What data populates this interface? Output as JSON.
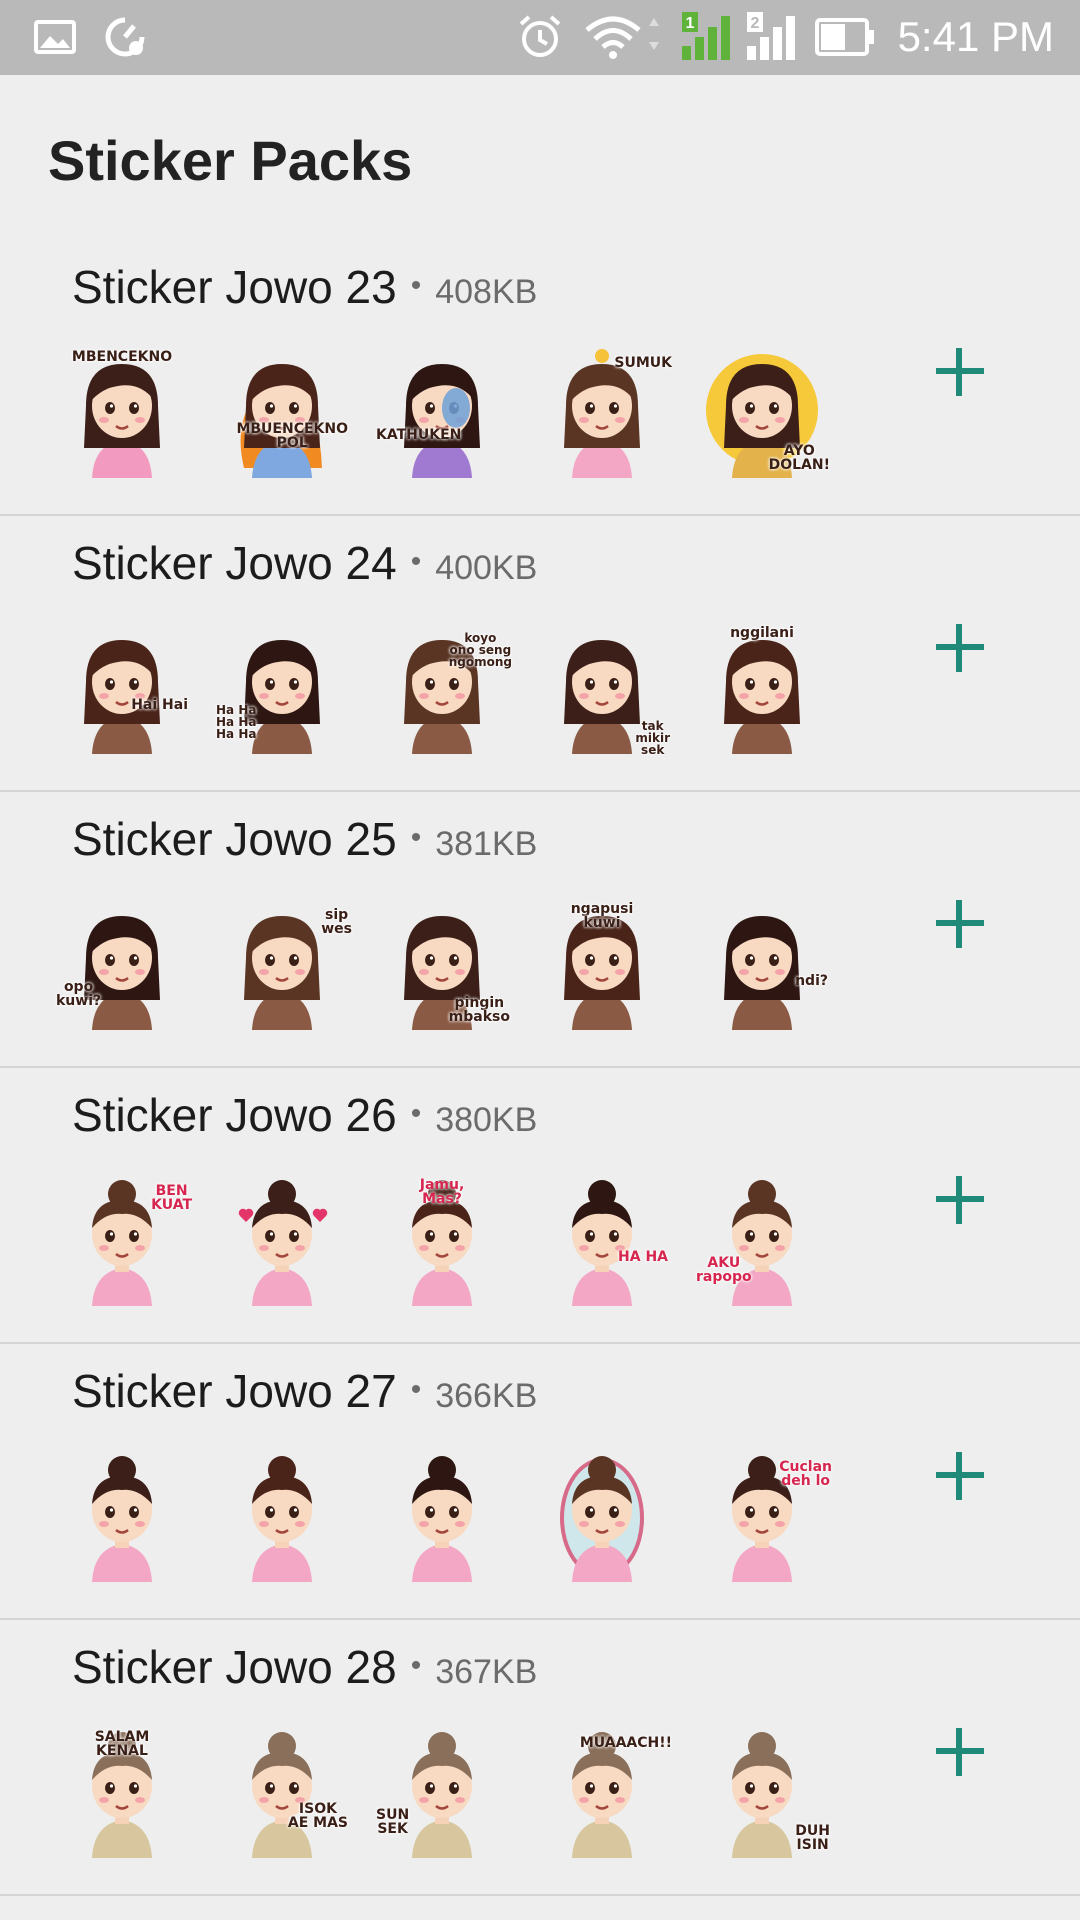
{
  "status_bar": {
    "time": "5:41 PM",
    "icons": [
      "gallery-icon",
      "sync-settings-icon",
      "alarm-icon",
      "wifi-icon",
      "signal-sim1-icon",
      "signal-sim2-icon",
      "battery-icon"
    ],
    "sim1_label": "1",
    "sim2_label": "2",
    "accent_signal_color": "#5fb23a"
  },
  "page": {
    "title": "Sticker Packs"
  },
  "colors": {
    "background": "#eeeeee",
    "add_icon": "#1f8a78",
    "divider": "#d4d4d4"
  },
  "packs": [
    {
      "name": "Sticker Jowo 23",
      "size": "408KB",
      "stickers": [
        {
          "icon": "annoyed-girl-sticker",
          "caption": "MBENCEKNO"
        },
        {
          "icon": "angry-fire-girl-sticker",
          "caption": "MBUENCEKNO\nPOL"
        },
        {
          "icon": "shocked-girl-sticker",
          "caption": "KATHUKEN"
        },
        {
          "icon": "hot-weather-girl-sticker",
          "caption": "SUMUK"
        },
        {
          "icon": "pointing-girl-sticker",
          "caption": "AYO\nDOLAN!"
        }
      ]
    },
    {
      "name": "Sticker Jowo 24",
      "size": "400KB",
      "stickers": [
        {
          "icon": "waving-girl-sticker",
          "caption": "Hai  Hai"
        },
        {
          "icon": "laughing-girl-sticker",
          "caption": "Ha Ha\nHa Ha\nHa Ha"
        },
        {
          "icon": "thinking-girl-sticker",
          "caption": "koyo\nono seng\nngomong"
        },
        {
          "icon": "facepalm-girl-sticker",
          "caption": "tak\nmikir\nsek"
        },
        {
          "icon": "surprised-girl-sticker",
          "caption": "nggilani"
        }
      ]
    },
    {
      "name": "Sticker Jowo 25",
      "size": "381KB",
      "stickers": [
        {
          "icon": "gasping-girl-sticker",
          "caption": "opo\nkuwi?"
        },
        {
          "icon": "winking-girl-sticker",
          "caption": "sip\nwes"
        },
        {
          "icon": "hungry-girl-sticker",
          "caption": "pingin\nmbakso"
        },
        {
          "icon": "lying-girl-sticker",
          "caption": "ngapusi\nkuwi"
        },
        {
          "icon": "confused-girl-sticker",
          "caption": "ndi?"
        }
      ]
    },
    {
      "name": "Sticker Jowo 26",
      "size": "380KB",
      "stickers": [
        {
          "icon": "strong-woman-sticker",
          "caption": "BEN\nKUAT"
        },
        {
          "icon": "love-woman-sticker",
          "caption": ""
        },
        {
          "icon": "herbal-woman-sticker",
          "caption": "Jamu,\nMas?"
        },
        {
          "icon": "laughing-woman-sticker",
          "caption": "HA  HA"
        },
        {
          "icon": "fine-woman-sticker",
          "caption": "AKU\nrapopo"
        }
      ]
    },
    {
      "name": "Sticker Jowo 27",
      "size": "366KB",
      "stickers": [
        {
          "icon": "flexing-woman-sticker",
          "caption": ""
        },
        {
          "icon": "excited-woman-sticker",
          "caption": ""
        },
        {
          "icon": "wondering-woman-sticker",
          "caption": ""
        },
        {
          "icon": "mirror-woman-sticker",
          "caption": ""
        },
        {
          "icon": "sad-woman-sticker",
          "caption": "Cuclan\ndeh lo"
        }
      ]
    },
    {
      "name": "Sticker Jowo 28",
      "size": "367KB",
      "stickers": [
        {
          "icon": "greeting-grandma-sticker",
          "caption": "SALAM\nKENAL"
        },
        {
          "icon": "cheeky-grandma-sticker",
          "caption": "ISOK\nAE MAS"
        },
        {
          "icon": "kissing-grandma-sticker",
          "caption": "SUN\nSEK"
        },
        {
          "icon": "blowing-kiss-grandma-sticker",
          "caption": "MUAAACH!!"
        },
        {
          "icon": "excuse-me-grandma-sticker",
          "caption": "DUH\nISIN"
        }
      ]
    }
  ]
}
